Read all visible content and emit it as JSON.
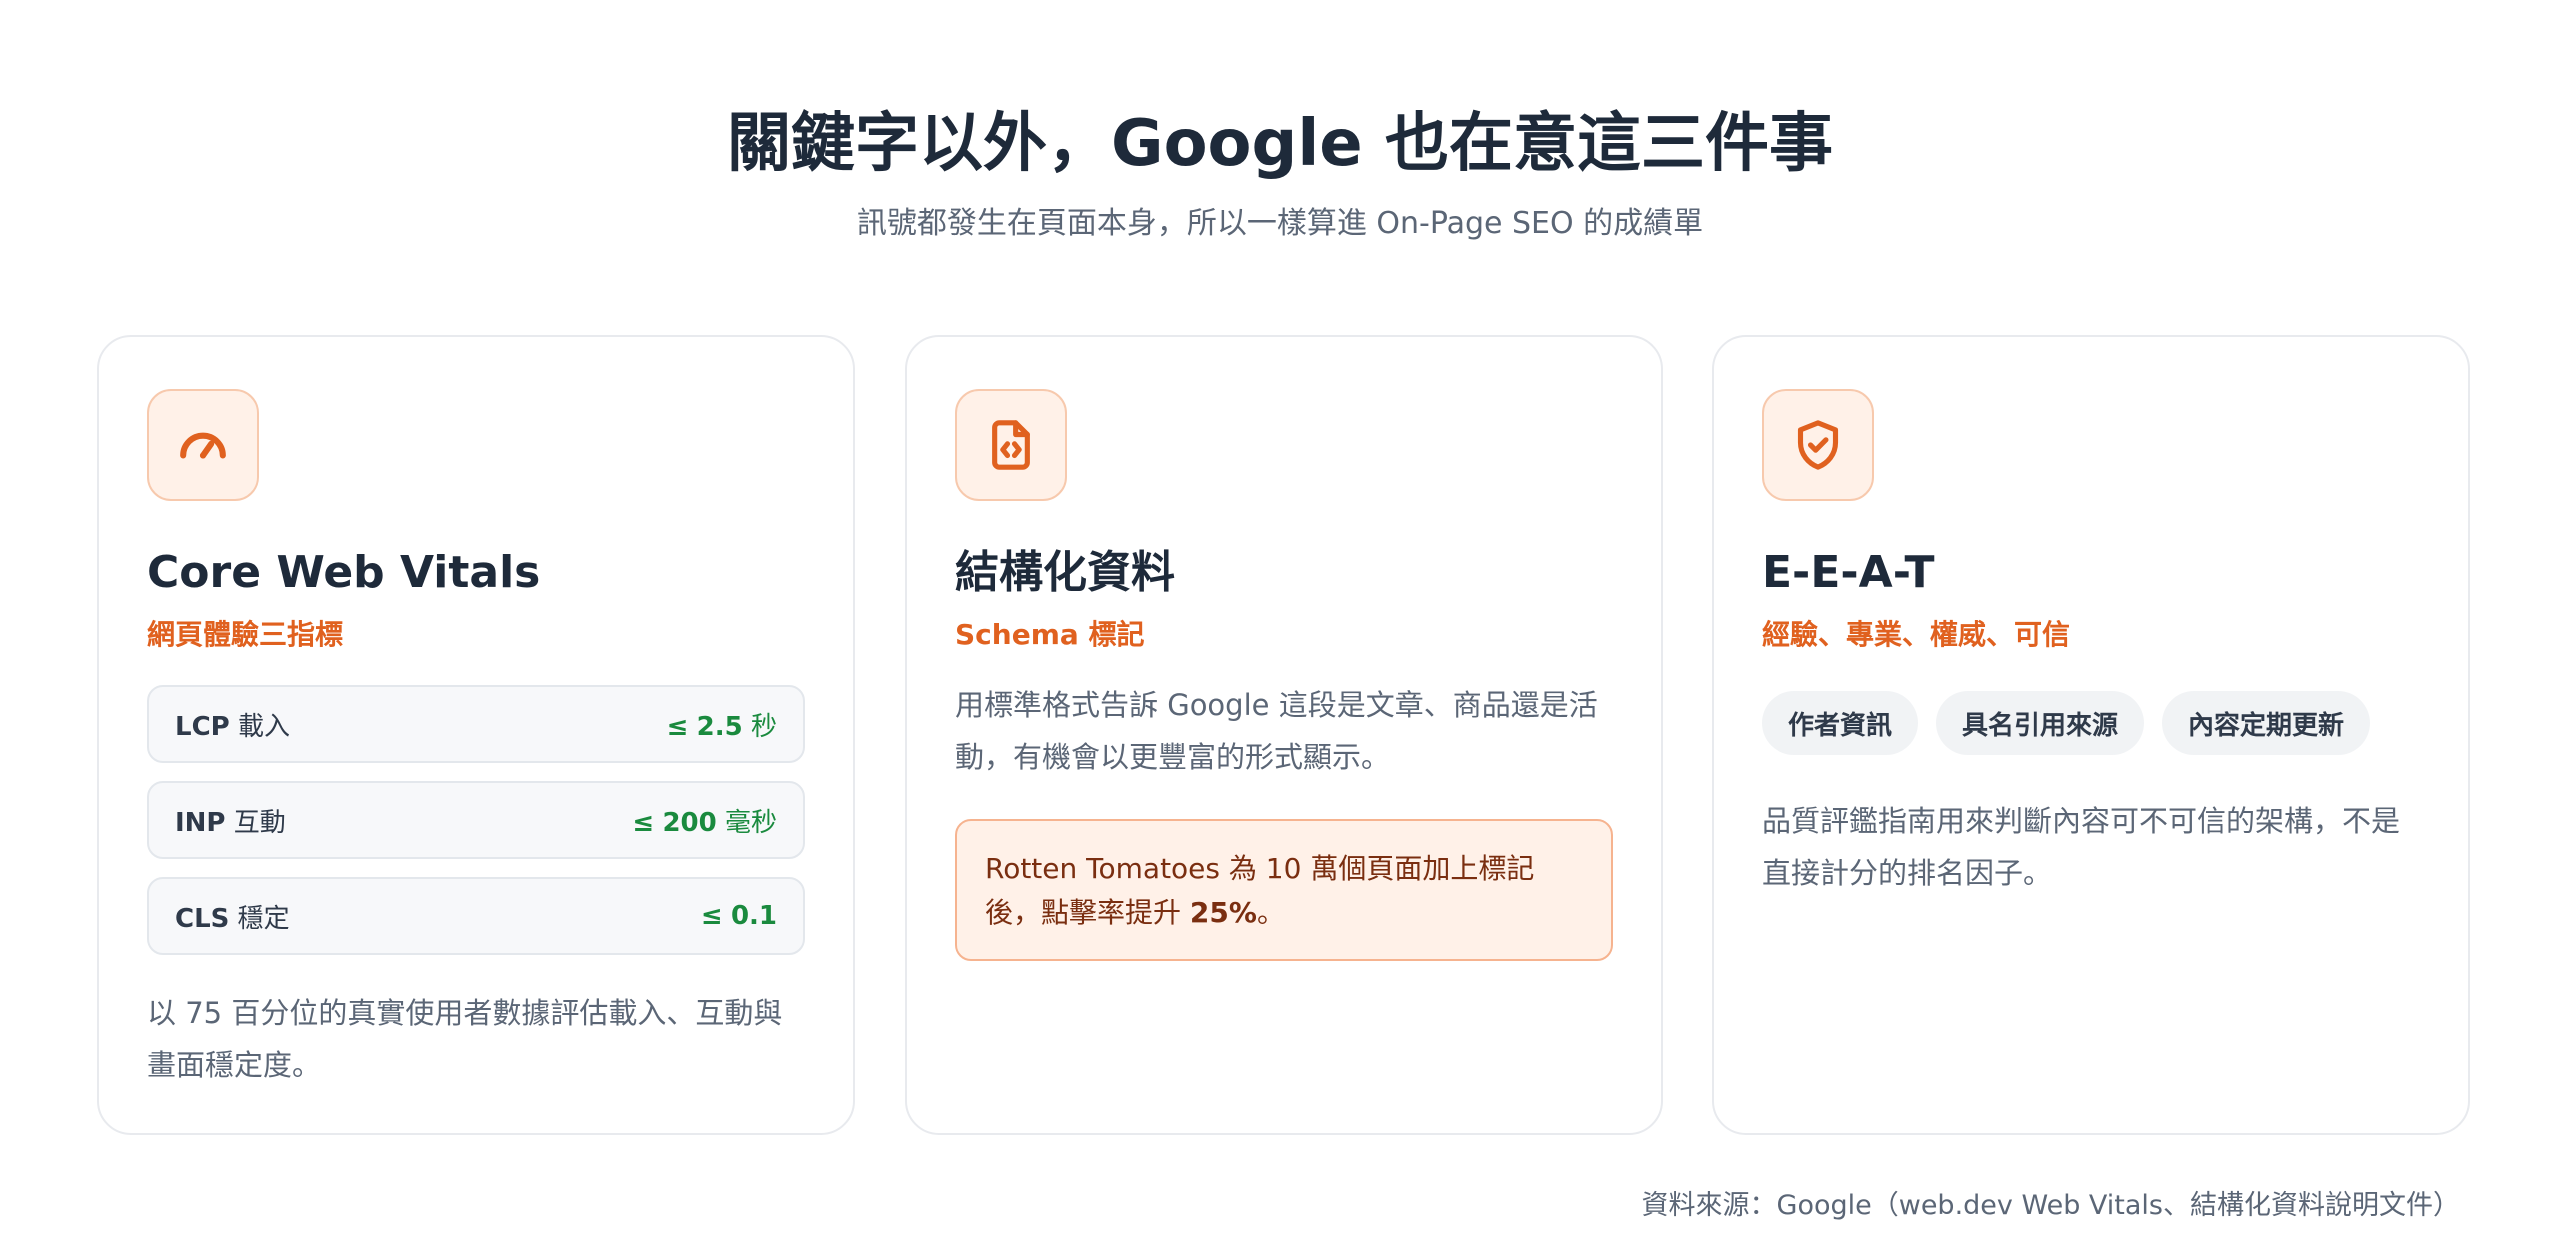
{
  "header": {
    "title": "關鍵字以外，Google 也在意這三件事",
    "subtitle": "訊號都發生在頁面本身，所以一樣算進 On-Page SEO 的成績單"
  },
  "cards": [
    {
      "icon": "speedometer-icon",
      "title": "Core Web Vitals",
      "subtitle": "網頁體驗三指標",
      "metrics": [
        {
          "name": "LCP",
          "name_suffix": "載入",
          "prefix": "≤",
          "value": "2.5",
          "unit": "秒"
        },
        {
          "name": "INP",
          "name_suffix": "互動",
          "prefix": "≤",
          "value": "200",
          "unit": "毫秒"
        },
        {
          "name": "CLS",
          "name_suffix": "穩定",
          "prefix": "≤",
          "value": "0.1",
          "unit": ""
        }
      ],
      "description": "以 75 百分位的真實使用者數據評估載入、互動與畫面穩定度。"
    },
    {
      "icon": "code-file-icon",
      "title": "結構化資料",
      "subtitle": "Schema 標記",
      "description": "用標準格式告訴 Google 這段是文章、商品還是活動，有機會以更豐富的形式顯示。",
      "callout": {
        "text": "Rotten Tomatoes 為 10 萬個頁面加上標記後，點擊率提升 ",
        "highlight": "25%",
        "suffix": "。"
      }
    },
    {
      "icon": "shield-check-icon",
      "title": "E-E-A-T",
      "subtitle": "經驗、專業、權威、可信",
      "tags": [
        "作者資訊",
        "具名引用來源",
        "內容定期更新"
      ],
      "description": "品質評鑑指南用來判斷內容可不可信的架構，不是直接計分的排名因子。"
    }
  ],
  "source": "資料來源：Google（web.dev Web Vitals、結構化資料說明文件）",
  "colors": {
    "accent": "#e0611f",
    "metric_good": "#1a8a3e",
    "title": "#1e2a3a",
    "muted": "#5b6676"
  }
}
